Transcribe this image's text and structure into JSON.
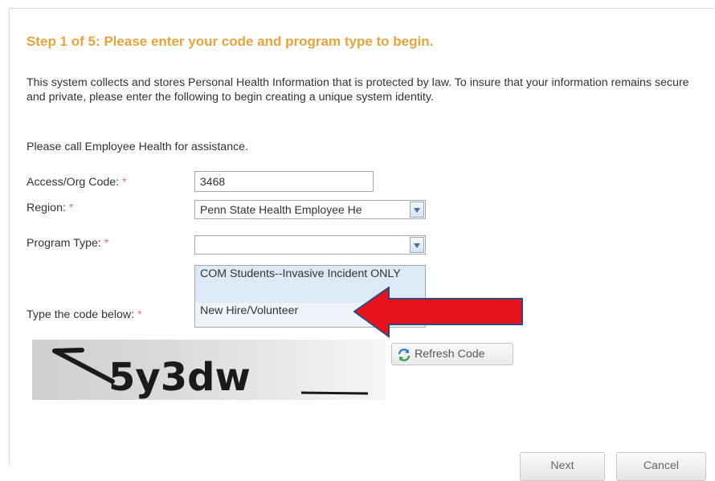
{
  "step_title": "Step 1 of 5: Please enter your code and program type to begin.",
  "intro_text": "This system collects and stores Personal Health Information that is protected by law. To insure that your information remains secure and private, please enter the following to begin creating a unique system identity.",
  "assist_text": "Please call Employee Health for assistance.",
  "required_mark": "*",
  "fields": {
    "access_code": {
      "label": "Access/Org Code:",
      "value": "3468"
    },
    "region": {
      "label": "Region:",
      "value": "Penn State Health Employee He"
    },
    "program_type": {
      "label": "Program Type:",
      "value": ""
    },
    "captcha_code": {
      "label": "Type the code below:"
    }
  },
  "program_type_options": [
    "COM Students--Invasive Incident ONLY",
    "New Hire/Volunteer"
  ],
  "captcha": {
    "text": "5y3dw"
  },
  "refresh_label": "Refresh Code",
  "buttons": {
    "next": "Next",
    "cancel": "Cancel"
  },
  "colors": {
    "title": "#e8a33d",
    "required": "#e07a6a",
    "annotation_arrow": "#e8121a"
  },
  "icons": {
    "dropdown": "chevron-down-icon",
    "refresh": "refresh-icon"
  }
}
